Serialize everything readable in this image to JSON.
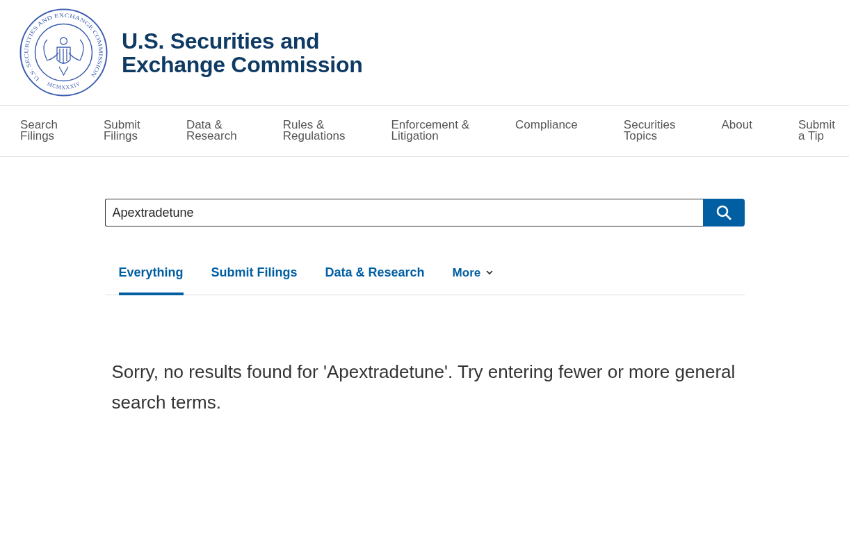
{
  "header": {
    "seal": {
      "ring_text": "U.S. SECURITIES AND EXCHANGE COMMISSION",
      "year_text": "MCMXXXIV"
    },
    "title_lines": [
      "U.S. Securities and",
      "Exchange Commission"
    ]
  },
  "nav": {
    "items": [
      {
        "label": "Search\nFilings"
      },
      {
        "label": "Submit\nFilings"
      },
      {
        "label": "Data &\nResearch"
      },
      {
        "label": "Rules &\nRegulations"
      },
      {
        "label": "Enforcement &\nLitigation"
      },
      {
        "label": "Compliance"
      },
      {
        "label": "Securities\nTopics"
      },
      {
        "label": "About"
      },
      {
        "label": "Submit\na Tip"
      }
    ]
  },
  "search": {
    "value": "Apextradetune"
  },
  "tabs": [
    {
      "label": "Everything",
      "selected": true,
      "kind": "tab"
    },
    {
      "label": "Submit Filings",
      "selected": false,
      "kind": "tab"
    },
    {
      "label": "Data & Research",
      "selected": false,
      "kind": "tab"
    },
    {
      "label": "More",
      "selected": false,
      "kind": "dropdown"
    }
  ],
  "message": "Sorry, no results found for 'Apextradetune'. Try entering fewer or more general search terms."
}
